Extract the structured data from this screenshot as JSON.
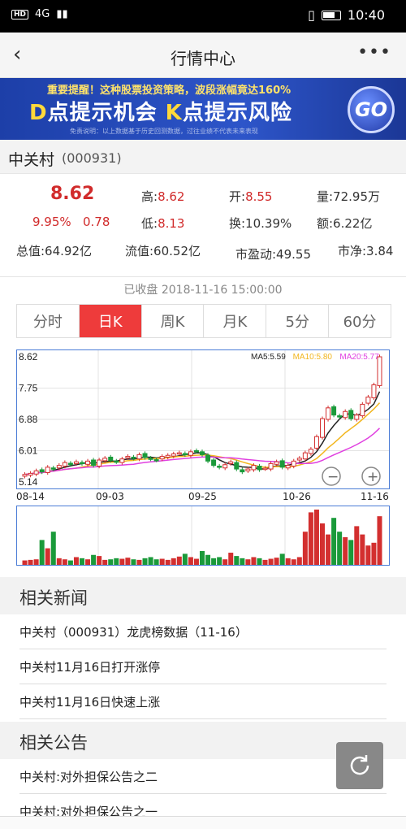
{
  "status": {
    "time": "10:40",
    "network": "4G"
  },
  "nav": {
    "title": "行情中心"
  },
  "banner": {
    "line1_prefix": "重要提醒！这种股票投资策略，波段涨幅竟达",
    "line1_pct": "160%",
    "line2_a": "D",
    "line2_b": "点提示机会",
    "line2_c": "K",
    "line2_d": "点提示风险",
    "disclaimer": "免责说明：以上数据基于历史回测数据，过往业绩不代表未来表现",
    "go": "GO"
  },
  "stock": {
    "name": "中关村",
    "code": "(000931)"
  },
  "quote": {
    "price": "8.62",
    "change_pct": "9.95%",
    "change": "0.78",
    "high_label": "高:",
    "high": "8.62",
    "open_label": "开:",
    "open": "8.55",
    "volume": "量:72.95万",
    "low_label": "低:",
    "low": "8.13",
    "turnover": "换:10.39%",
    "amount": "额:6.22亿",
    "total_cap": "总值:64.92亿",
    "float_cap": "流值:60.52亿",
    "pe": "市盈动:49.55",
    "pb": "市净:3.84"
  },
  "closed_text": "已收盘 2018-11-16 15:00:00",
  "tabs": [
    "分时",
    "日K",
    "周K",
    "月K",
    "5分",
    "60分"
  ],
  "chart_data": {
    "type": "candlestick",
    "y_ticks": [
      "8.62",
      "7.75",
      "6.88",
      "6.01",
      "5.14"
    ],
    "ylim": [
      5.14,
      8.62
    ],
    "ma_labels": [
      "MA5:5.59",
      "MA10:5.80",
      "MA20:5.77"
    ],
    "x_labels": [
      "08-14",
      "09-03",
      "09-25",
      "10-26",
      "11-16"
    ],
    "closes": [
      5.35,
      5.38,
      5.45,
      5.42,
      5.55,
      5.5,
      5.6,
      5.68,
      5.62,
      5.7,
      5.65,
      5.72,
      5.6,
      5.75,
      5.8,
      5.74,
      5.7,
      5.78,
      5.85,
      5.8,
      5.9,
      5.82,
      5.78,
      5.75,
      5.85,
      5.88,
      5.92,
      5.95,
      5.9,
      5.98,
      6.0,
      5.9,
      5.72,
      5.6,
      5.55,
      5.62,
      5.7,
      5.5,
      5.42,
      5.5,
      5.6,
      5.48,
      5.52,
      5.65,
      5.7,
      5.55,
      5.6,
      5.72,
      5.8,
      5.95,
      6.05,
      6.4,
      6.9,
      7.2,
      7.0,
      6.95,
      7.1,
      6.9,
      7.0,
      7.3,
      7.5,
      7.84,
      8.62
    ],
    "volumes": [
      8,
      9,
      10,
      45,
      30,
      60,
      12,
      10,
      8,
      14,
      12,
      10,
      18,
      16,
      9,
      10,
      12,
      11,
      13,
      10,
      9,
      12,
      14,
      10,
      11,
      9,
      12,
      15,
      20,
      14,
      11,
      25,
      18,
      12,
      14,
      10,
      22,
      16,
      12,
      10,
      14,
      12,
      9,
      11,
      13,
      20,
      12,
      10,
      14,
      60,
      95,
      100,
      75,
      55,
      85,
      60,
      50,
      45,
      70,
      55,
      35,
      40,
      88
    ],
    "ma_colors": {
      "ma5": "#222222",
      "ma10": "#f2b61e",
      "ma20": "#e040e0"
    },
    "up_color": "#d32f2f",
    "down_color": "#1a9a3a"
  },
  "news_title": "相关新闻",
  "news": [
    "中关村（000931）龙虎榜数据（11-16）",
    "中关村11月16日打开涨停",
    "中关村11月16日快速上涨"
  ],
  "notice_title": "相关公告",
  "notices": [
    "中关村:对外担保公告之二",
    "中关村:对外担保公告之一"
  ]
}
